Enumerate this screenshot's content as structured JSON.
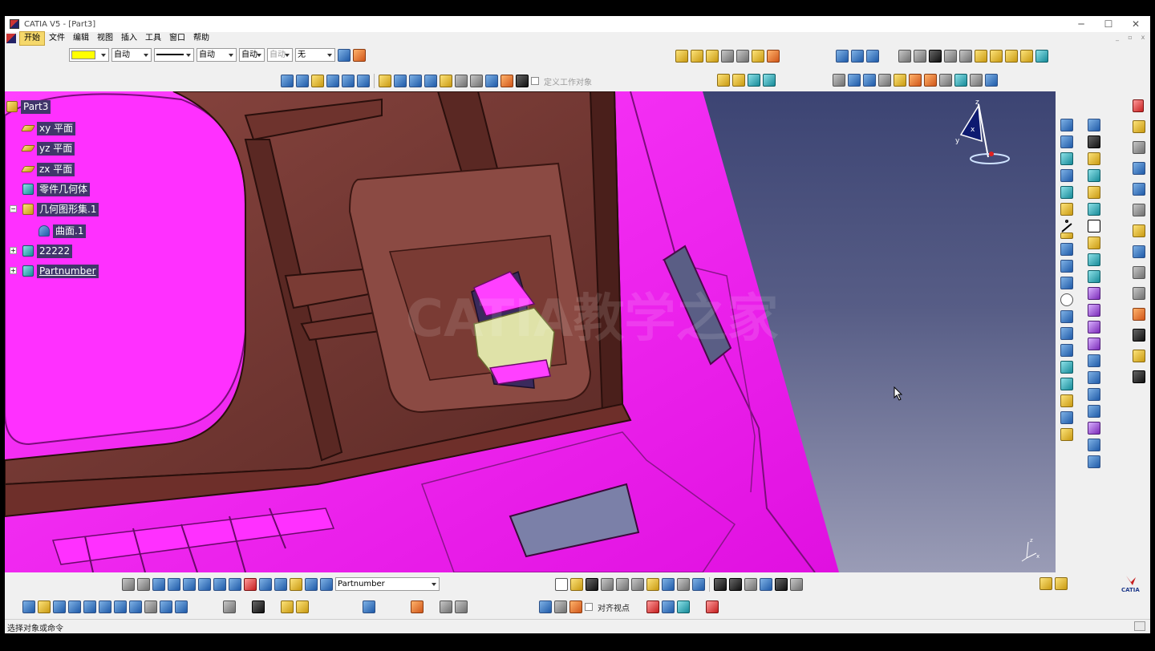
{
  "window": {
    "title": "CATIA V5 - [Part3]"
  },
  "menu": [
    "开始",
    "文件",
    "编辑",
    "视图",
    "插入",
    "工具",
    "窗口",
    "帮助"
  ],
  "graphic_properties": {
    "fill_color": "#ffff00",
    "transparency": "自动",
    "line_type": "自动",
    "thickness": "自动",
    "point": "自动",
    "layer": "无"
  },
  "work_object_label": "定义工作对象",
  "tree": {
    "root": "Part3",
    "nodes": [
      {
        "label": "xy 平面",
        "icon": "plane-icon"
      },
      {
        "label": "yz 平面",
        "icon": "plane-icon"
      },
      {
        "label": "zx 平面",
        "icon": "plane-icon"
      },
      {
        "label": "零件几何体",
        "icon": "body-gear-icon"
      },
      {
        "label": "几何图形集.1",
        "icon": "geometrical-set-icon"
      },
      {
        "label": "曲面.1",
        "icon": "surface-icon"
      },
      {
        "label": "22222",
        "icon": "body-gear-icon"
      },
      {
        "label": "Partnumber",
        "icon": "body-gear-icon"
      }
    ]
  },
  "compass": {
    "x": "x",
    "y": "y",
    "z": "z"
  },
  "mini_axis": {
    "z": "z",
    "x": "x"
  },
  "watermark": "CATIA教学之家",
  "bottom_combo": "Partnumber",
  "align_view_label": "对齐视点",
  "status": "选择对象或命令",
  "colors": {
    "model_magenta": "#ff24ff",
    "model_brown": "#7a3b34",
    "background_top": "#3c4473"
  }
}
